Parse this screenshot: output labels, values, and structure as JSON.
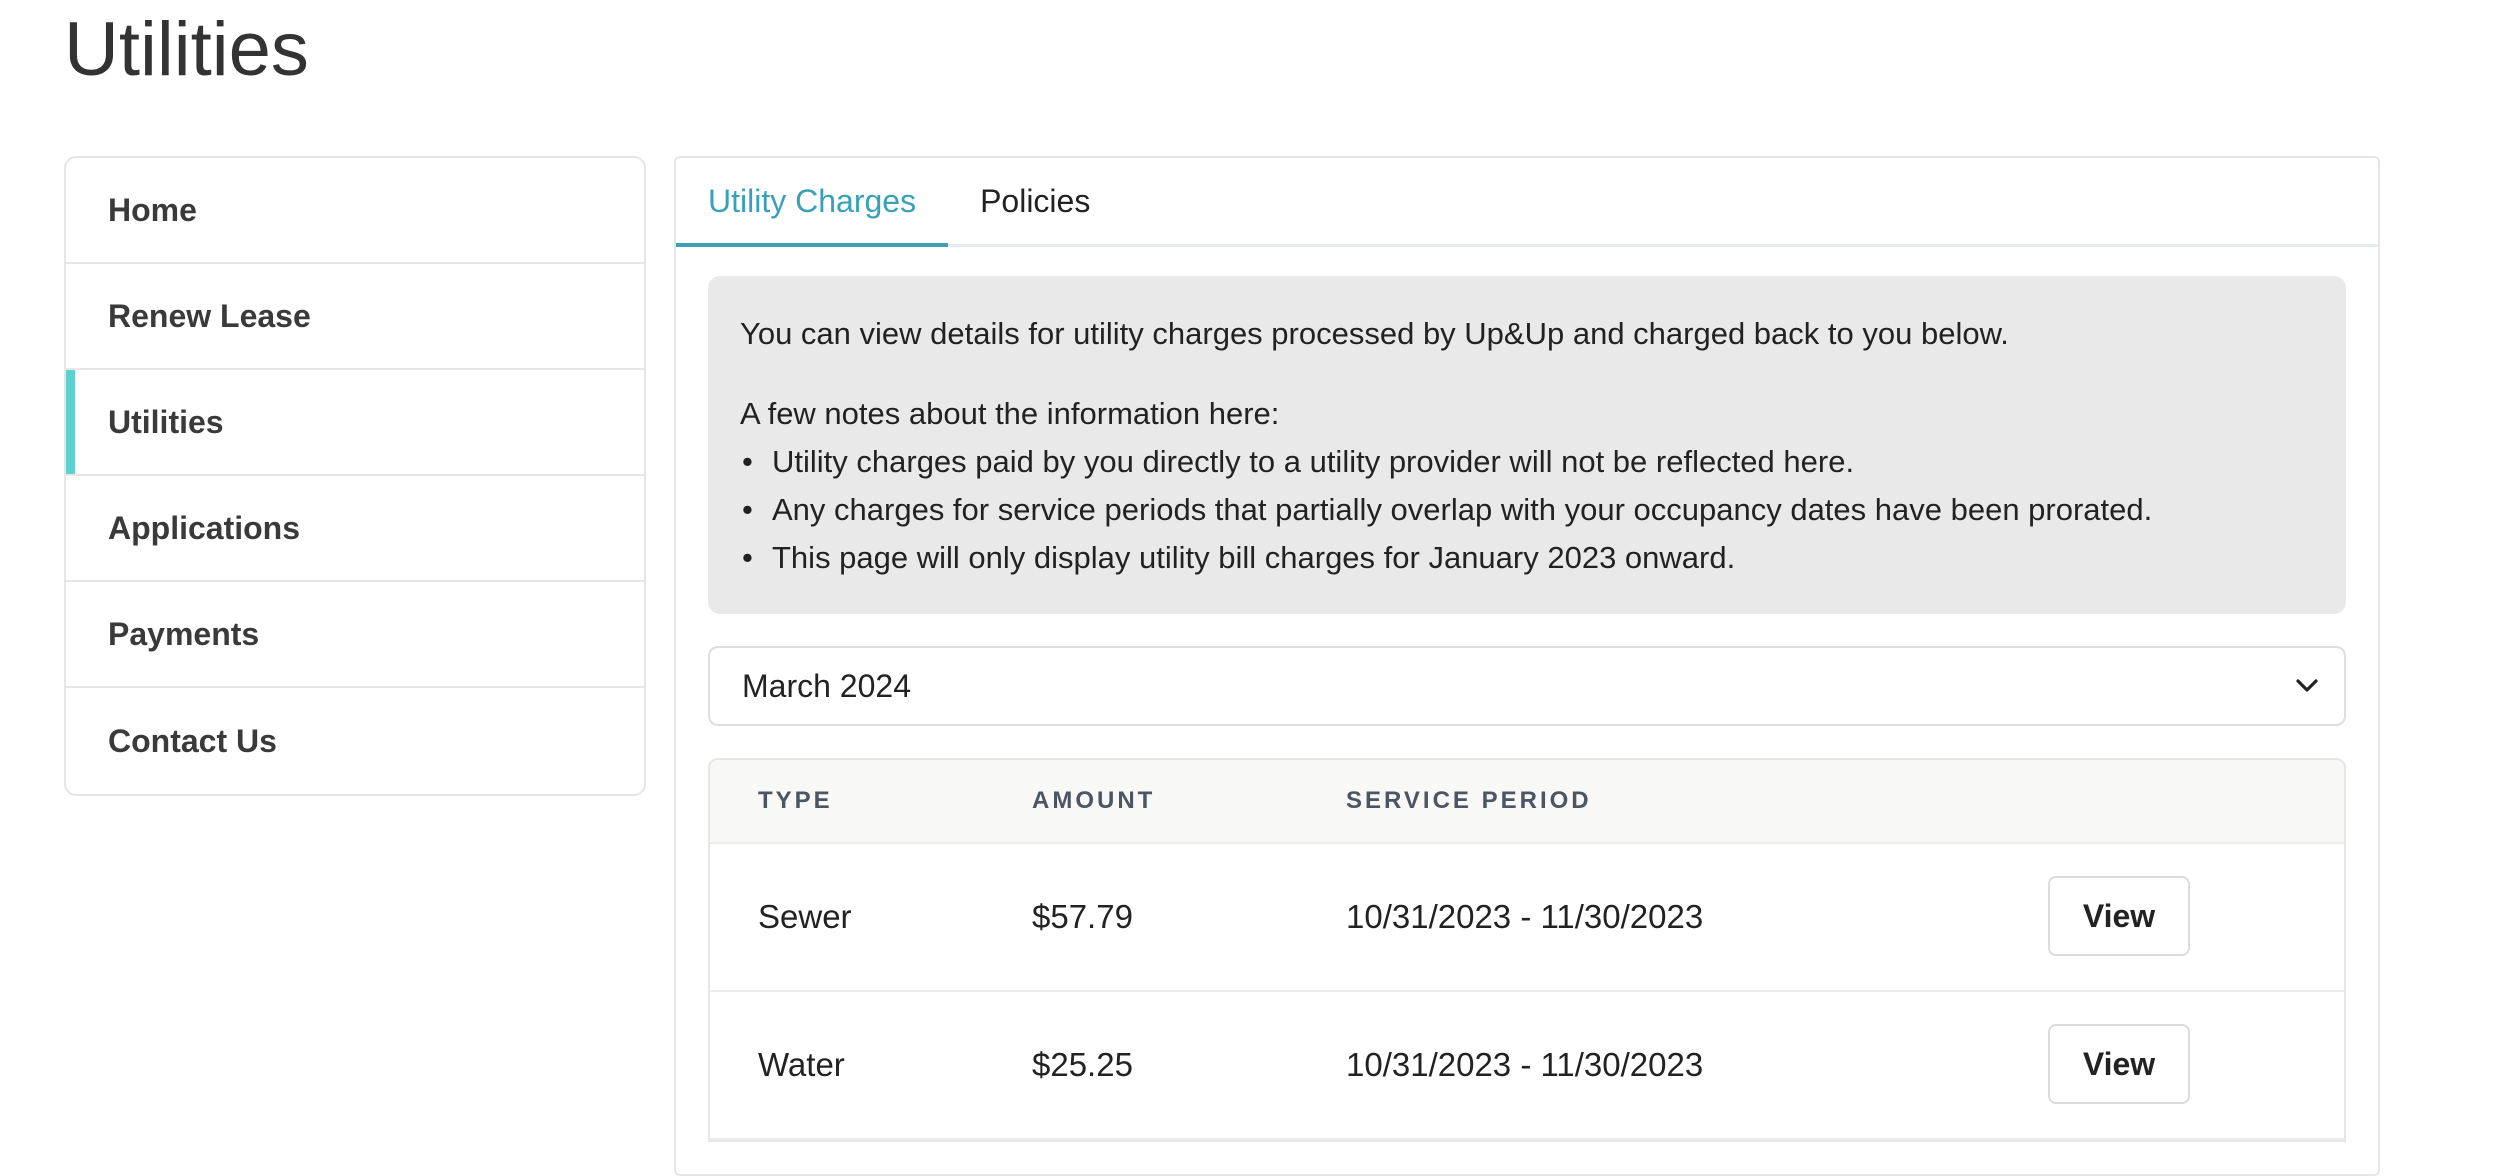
{
  "page": {
    "title": "Utilities"
  },
  "sidebar": {
    "items": [
      {
        "label": "Home"
      },
      {
        "label": "Renew Lease"
      },
      {
        "label": "Utilities"
      },
      {
        "label": "Applications"
      },
      {
        "label": "Payments"
      },
      {
        "label": "Contact Us"
      }
    ],
    "active": "Utilities",
    "accent_color": "#5ed0cf"
  },
  "tabs": [
    {
      "label": "Utility Charges"
    },
    {
      "label": "Policies"
    }
  ],
  "active_tab": "Utility Charges",
  "tab_accent_color": "#3aa0b8",
  "info": {
    "intro": "You can view details for utility charges processed by Up&Up and charged back to you below.",
    "notes_heading": "A few notes about the information here:",
    "notes": [
      "Utility charges paid by you directly to a utility provider will not be reflected here.",
      "Any charges for service periods that partially overlap with your occupancy dates have been prorated.",
      "This page will only display utility bill charges for January 2023 onward."
    ]
  },
  "month_select": {
    "value": "March 2024",
    "icon": "chevron-down-icon"
  },
  "table": {
    "headers": {
      "type": "TYPE",
      "amount": "AMOUNT",
      "service_period": "SERVICE PERIOD"
    },
    "rows": [
      {
        "type": "Sewer",
        "amount": "$57.79",
        "service_period": "10/31/2023 - 11/30/2023",
        "action": "View"
      },
      {
        "type": "Water",
        "amount": "$25.25",
        "service_period": "10/31/2023 - 11/30/2023",
        "action": "View"
      }
    ]
  }
}
